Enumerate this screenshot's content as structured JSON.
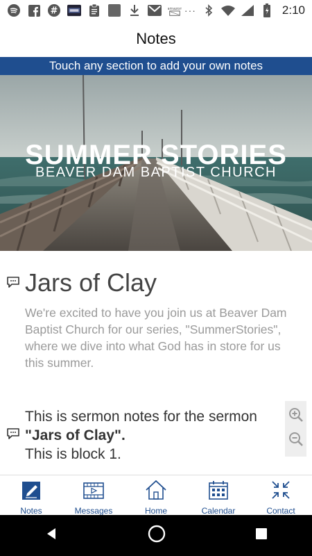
{
  "status_bar": {
    "time": "2:10",
    "left_icons": [
      "spotify-icon",
      "facebook-icon",
      "slack-icon",
      "game-thumbnail-icon",
      "clipboard-icon",
      "square-app-icon",
      "download-icon",
      "gmail-icon",
      "amazon-icon"
    ],
    "more": "···"
  },
  "app_bar": {
    "title": "Notes"
  },
  "banner": {
    "text": "Touch any section to add your own notes"
  },
  "hero": {
    "headline": "SUMMER STORIES",
    "subhead": "BEAVER DAM BAPTIST CHURCH"
  },
  "section1": {
    "title": "Jars of Clay",
    "body": "We're excited to have you join us at Beaver Dam Baptist Church for our series, \"SummerStories\", where we dive into what God has in store for us this summer."
  },
  "block2": {
    "line1": "This is sermon notes for the sermon",
    "bold": "\"Jars of Clay\".",
    "line3": "This is block 1."
  },
  "tabs": [
    {
      "label": "Notes",
      "icon": "notes-icon",
      "active": true
    },
    {
      "label": "Messages",
      "icon": "film-icon",
      "active": false
    },
    {
      "label": "Home",
      "icon": "home-icon",
      "active": false
    },
    {
      "label": "Calendar",
      "icon": "calendar-icon",
      "active": false
    },
    {
      "label": "Contact",
      "icon": "contact-icon",
      "active": false
    }
  ],
  "colors": {
    "brand": "#1f4e8f",
    "banner": "#1f4e8f"
  }
}
